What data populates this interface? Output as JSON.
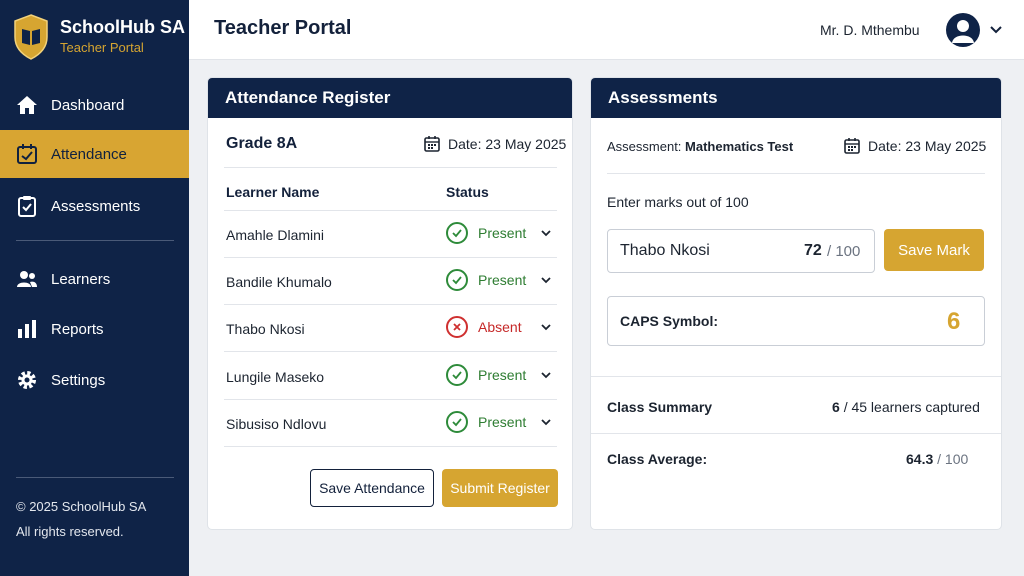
{
  "brand": {
    "name": "SchoolHub SA",
    "subtitle": "Teacher Portal"
  },
  "nav": [
    {
      "label": "Dashboard",
      "icon": "home-icon",
      "active": false
    },
    {
      "label": "Attendance",
      "icon": "calendar-check-icon",
      "active": true
    },
    {
      "label": "Assessments",
      "icon": "clipboard-check-icon",
      "active": false
    },
    {
      "label": "Learners",
      "icon": "users-icon",
      "active": false
    },
    {
      "label": "Reports",
      "icon": "bar-chart-icon",
      "active": false
    },
    {
      "label": "Settings",
      "icon": "gear-icon",
      "active": false
    }
  ],
  "footer": {
    "line1": "© 2025 SchoolHub SA",
    "line2": "All rights reserved."
  },
  "header": {
    "title": "Teacher Portal",
    "user": "Mr. D. Mthembu"
  },
  "attendance": {
    "title": "Attendance Register",
    "grade": "Grade 8A",
    "date": "Date: 23 May 2025",
    "col_name": "Learner Name",
    "col_status": "Status",
    "rows": [
      {
        "name": "Amahle Dlamini",
        "status": "Present"
      },
      {
        "name": "Bandile Khumalo",
        "status": "Present"
      },
      {
        "name": "Thabo Nkosi",
        "status": "Absent"
      },
      {
        "name": "Lungile Maseko",
        "status": "Present"
      },
      {
        "name": "Sibusiso Ndlovu",
        "status": "Present"
      }
    ],
    "save_label": "Save Attendance",
    "submit_label": "Submit Register"
  },
  "assessments": {
    "title": "Assessments",
    "assessment_label": "Assessment:",
    "assessment_name": "Mathematics Test",
    "date": "Date: 23 May 2025",
    "instruction": "Enter marks out of 100",
    "learner": "Thabo Nkosi",
    "mark": "72",
    "mark_total": "/ 100",
    "save_mark_label": "Save Mark",
    "caps_label": "CAPS Symbol:",
    "caps_value": "6",
    "summary_label": "Class Summary",
    "summary_count": "6",
    "summary_text": "/ 45 learners captured",
    "average_label": "Class Average:",
    "average_value": "64.3",
    "average_total": "/ 100"
  },
  "colors": {
    "navy": "#0f2347",
    "gold": "#d6a531",
    "present": "#2e7d32",
    "absent": "#c62828"
  }
}
